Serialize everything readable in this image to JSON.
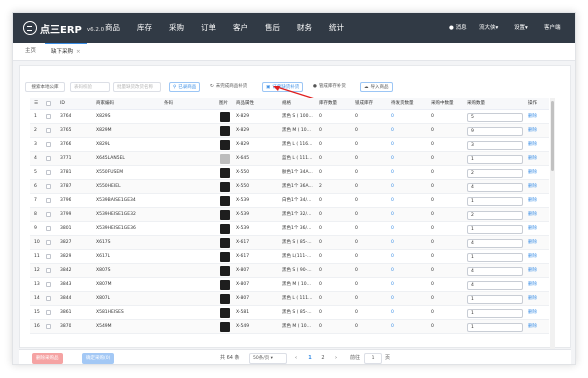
{
  "nav": {
    "logo_text": "点三ERP",
    "version": "v6.2.0",
    "menu": [
      "商品",
      "库存",
      "采购",
      "订单",
      "客户",
      "售后",
      "财务",
      "统计"
    ],
    "notice": "消息",
    "user": "流大侠",
    "settings": "设置",
    "service": "客户端"
  },
  "tabs": [
    {
      "label": "主页"
    },
    {
      "label": "缺下采购",
      "close": "×"
    }
  ],
  "toolbar": {
    "filter_button": "搜索本地公库",
    "input1_placeholder": "表码校验",
    "input2_placeholder": "批量缺货改货名称",
    "search_button": "搜索",
    "btn_entered": "已录商品",
    "btn_not_entered": "未完成商品补货",
    "btn_order": "订单缺货补货",
    "btn_stock": "管成库存补货",
    "btn_import": "导入商品"
  },
  "table": {
    "headers": [
      "ID",
      "商家编码",
      "条码",
      "图片",
      "商品属性",
      "规格",
      "库存数量",
      "锁成库存",
      "待发货数量",
      "采购中数量",
      "采购数量",
      "操作"
    ],
    "rows": [
      {
        "no": "1",
        "id": "3764",
        "code": "X829S",
        "attr": "X-829",
        "spec": "黑色 S ( 100...",
        "stock": "0",
        "locked": "0",
        "pending": "0",
        "purchasing": "0",
        "qty": "5",
        "op": "删除"
      },
      {
        "no": "2",
        "id": "3765",
        "code": "X829M",
        "attr": "X-829",
        "spec": "黑色 M ( 10...",
        "stock": "0",
        "locked": "0",
        "pending": "0",
        "purchasing": "0",
        "qty": "9",
        "op": "删除"
      },
      {
        "no": "3",
        "id": "3766",
        "code": "X829L",
        "attr": "X-829",
        "spec": "黑色 L ( 116...",
        "stock": "0",
        "locked": "0",
        "pending": "0",
        "purchasing": "0",
        "qty": "3",
        "op": "删除"
      },
      {
        "no": "4",
        "id": "3771",
        "code": "X645LAN5EL",
        "attr": "X-645",
        "spec": "蓝色 L ( 111...",
        "stock": "0",
        "locked": "0",
        "pending": "0",
        "purchasing": "0",
        "qty": "1",
        "op": "删除"
      },
      {
        "no": "5",
        "id": "3781",
        "code": "X550FUSEM",
        "attr": "X-550",
        "spec": "肤色1个 34A...",
        "stock": "0",
        "locked": "0",
        "pending": "0",
        "purchasing": "0",
        "qty": "2",
        "op": "删除"
      },
      {
        "no": "6",
        "id": "3787",
        "code": "X550HEIEL",
        "attr": "X-550",
        "spec": "黑色1个 36A...",
        "stock": "2",
        "locked": "0",
        "pending": "0",
        "purchasing": "0",
        "qty": "4",
        "op": "删除"
      },
      {
        "no": "7",
        "id": "3796",
        "code": "X539BAISE1GE34",
        "attr": "X-539",
        "spec": "白色1个 34/...",
        "stock": "0",
        "locked": "0",
        "pending": "0",
        "purchasing": "0",
        "qty": "1",
        "op": "删除"
      },
      {
        "no": "8",
        "id": "3799",
        "code": "X539HEISE1GE32",
        "attr": "X-539",
        "spec": "黑色1个 32/...",
        "stock": "0",
        "locked": "0",
        "pending": "0",
        "purchasing": "0",
        "qty": "2",
        "op": "删除"
      },
      {
        "no": "9",
        "id": "3801",
        "code": "X539HEISE1GE36",
        "attr": "X-539",
        "spec": "黑色1个 36/...",
        "stock": "0",
        "locked": "0",
        "pending": "0",
        "purchasing": "0",
        "qty": "1",
        "op": "删除"
      },
      {
        "no": "10",
        "id": "3827",
        "code": "X617S",
        "attr": "X-617",
        "spec": "黑色 S ( 85-...",
        "stock": "0",
        "locked": "0",
        "pending": "0",
        "purchasing": "0",
        "qty": "4",
        "op": "删除"
      },
      {
        "no": "11",
        "id": "3829",
        "code": "X617L",
        "attr": "X-617",
        "spec": "黑色 L(111-...",
        "stock": "0",
        "locked": "0",
        "pending": "0",
        "purchasing": "0",
        "qty": "1",
        "op": "删除"
      },
      {
        "no": "12",
        "id": "3842",
        "code": "X807S",
        "attr": "X-807",
        "spec": "黑色 S ( 90-...",
        "stock": "0",
        "locked": "0",
        "pending": "0",
        "purchasing": "0",
        "qty": "4",
        "op": "删除"
      },
      {
        "no": "13",
        "id": "3843",
        "code": "X807M",
        "attr": "X-807",
        "spec": "黑色 M ( 10...",
        "stock": "0",
        "locked": "0",
        "pending": "0",
        "purchasing": "0",
        "qty": "4",
        "op": "删除"
      },
      {
        "no": "14",
        "id": "3844",
        "code": "X807L",
        "attr": "X-807",
        "spec": "黑色 L ( 111...",
        "stock": "0",
        "locked": "0",
        "pending": "0",
        "purchasing": "0",
        "qty": "1",
        "op": "删除"
      },
      {
        "no": "15",
        "id": "3861",
        "code": "X581HEISES",
        "attr": "X-581",
        "spec": "黑色 S ( 85-...",
        "stock": "0",
        "locked": "0",
        "pending": "0",
        "purchasing": "0",
        "qty": "1",
        "op": "删除"
      },
      {
        "no": "16",
        "id": "3870",
        "code": "X549M",
        "attr": "X-549",
        "spec": "黑色 M ( 10...",
        "stock": "0",
        "locked": "0",
        "pending": "0",
        "purchasing": "0",
        "qty": "1",
        "op": "删除"
      }
    ]
  },
  "footer": {
    "delete_button": "删除采购品",
    "confirm_button": "确定采购(0)",
    "total": "共 64 条",
    "page_size": "50条/页",
    "prev": "‹",
    "pages": [
      "1",
      "2"
    ],
    "next": "›",
    "goto_label": "前往",
    "goto_value": "1",
    "page_unit": "页"
  },
  "colors": {
    "nav_bg": "#313a45",
    "accent": "#3a8ee6",
    "danger_btn": "#f5a3a3",
    "arrow": "#e02020"
  },
  "icons": {
    "logo": "erp-logo-icon",
    "search": "search-icon",
    "sort": "sort-icon",
    "scroll": "scrollbar"
  }
}
